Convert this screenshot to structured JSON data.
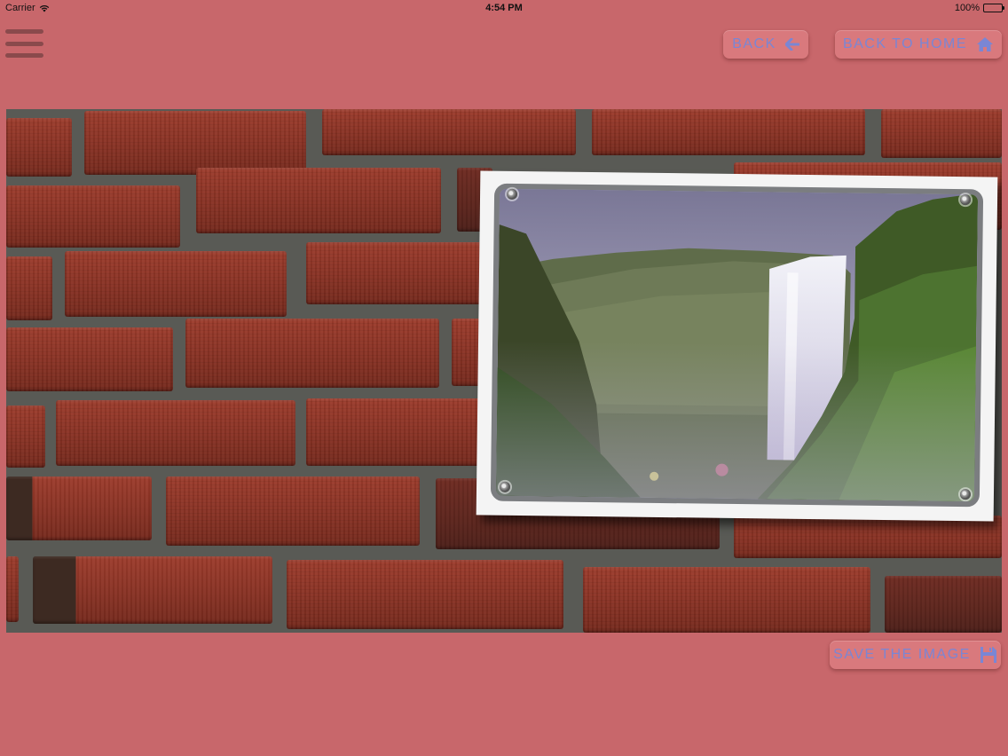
{
  "status_bar": {
    "carrier": "Carrier",
    "time": "4:54 PM",
    "battery": "100%"
  },
  "toolbar": {
    "menu_icon": "hamburger-menu-icon",
    "back_label": "BACK",
    "back_icon": "arrow-left-icon",
    "home_label": "BACK TO HOME",
    "home_icon": "house-icon"
  },
  "footer": {
    "save_label": "SAVE THE IMAGE",
    "save_icon": "floppy-disk-icon"
  },
  "colors": {
    "background": "#c8676b",
    "button_bg": "#d9797d",
    "button_text": "#7a86d4",
    "menu_icon": "#8a4a4c"
  },
  "canvas": {
    "background_image": "red brick wall",
    "framed_photo": "waterfall landscape in white metal frame"
  }
}
